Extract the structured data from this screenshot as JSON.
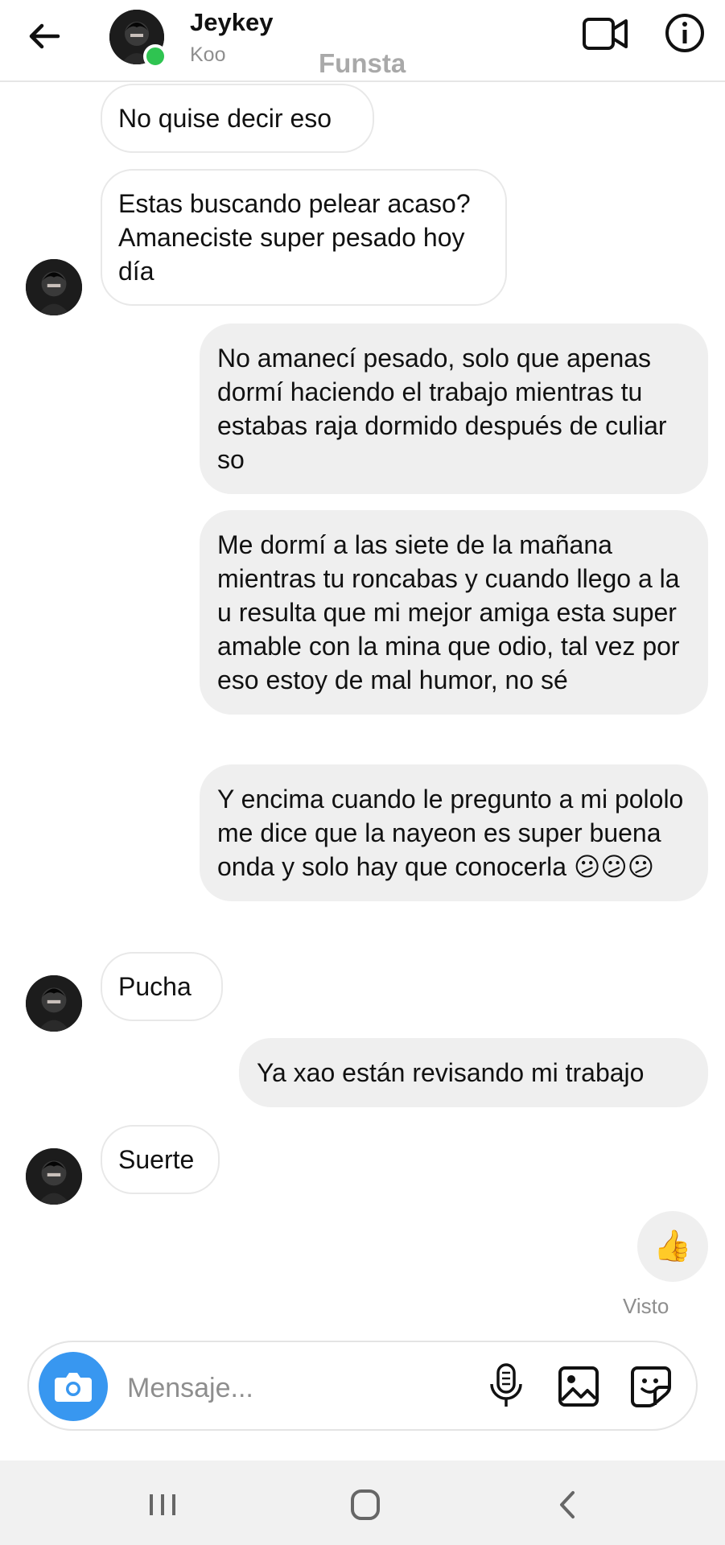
{
  "header": {
    "contact_name": "Jeykey",
    "contact_sub": "Koo",
    "overlay_text": "Funsta",
    "icons": [
      "back-arrow-icon",
      "video-call-icon",
      "info-icon"
    ]
  },
  "messages": [
    {
      "from": "them",
      "text": "No quise decir eso"
    },
    {
      "from": "them",
      "text": "Estas buscando pelear acaso? Amaneciste super pesado hoy día"
    },
    {
      "from": "me",
      "text": "No amanecí pesado, solo que apenas dormí haciendo el trabajo mientras tu estabas raja dormido después de culiar so"
    },
    {
      "from": "me",
      "text": "Me dormí a las siete de la mañana mientras tu roncabas y cuando llego a la u resulta que mi mejor amiga esta super amable con la mina que odio, tal vez por eso estoy de mal humor, no sé"
    },
    {
      "from": "me",
      "text": "Y encima cuando le pregunto a mi pololo me dice que la nayeon es super buena onda y solo hay que conocerla 😕😕😕"
    },
    {
      "from": "them",
      "text": "Pucha"
    },
    {
      "from": "me",
      "text": "Ya xao están revisando mi trabajo"
    },
    {
      "from": "them",
      "text": "Suerte"
    },
    {
      "from": "me",
      "text": "👍"
    }
  ],
  "seen_label": "Visto",
  "composer": {
    "placeholder": "Mensaje...",
    "icons": [
      "camera-icon",
      "microphone-icon",
      "gallery-icon",
      "sticker-icon"
    ]
  },
  "navbar": {
    "icons": [
      "recent-apps-icon",
      "home-icon",
      "back-icon"
    ]
  },
  "colors": {
    "online": "#2fc451",
    "camera_button": "#3897f0",
    "outgoing_bubble": "#efefef",
    "incoming_border": "#e8e8e8"
  }
}
